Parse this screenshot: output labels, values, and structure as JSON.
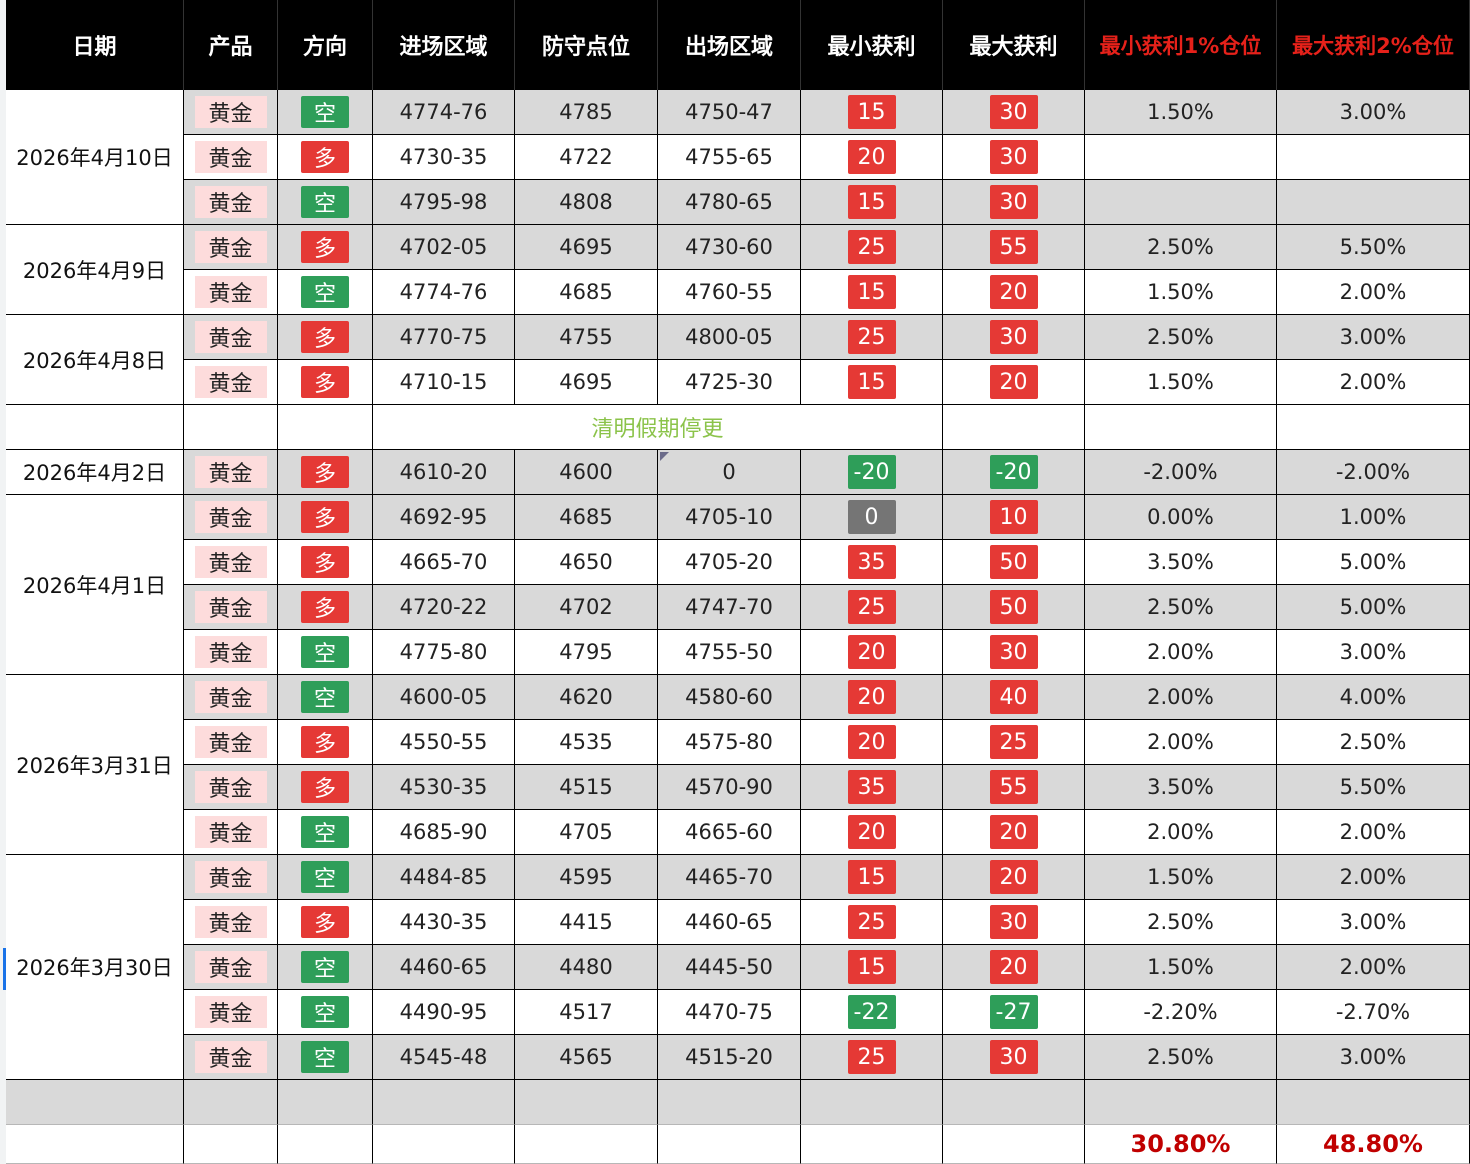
{
  "headers": [
    "日期",
    "产品",
    "方向",
    "进场区域",
    "防守点位",
    "出场区域",
    "最小获利",
    "最大获利",
    "最小获利1%仓位",
    "最大获利2%仓位"
  ],
  "colors": {
    "long": "#e53935",
    "short": "#2e9e59",
    "profit": "#e53935",
    "loss": "#2e9e59",
    "zero": "#757575",
    "header_bg": "#000000",
    "header_red": "#e6211a",
    "product_bg": "#fddcdc",
    "note": "#8bc34a",
    "total": "#c00000"
  },
  "groups": [
    {
      "date": "2026年4月10日",
      "rows": [
        {
          "product": "黄金",
          "direction": "空",
          "entry": "4774-76",
          "defense": "4785",
          "exit": "4750-47",
          "min_profit": "15",
          "max_profit": "30",
          "min_pct": "1.50%",
          "max_pct": "3.00%"
        },
        {
          "product": "黄金",
          "direction": "多",
          "entry": "4730-35",
          "defense": "4722",
          "exit": "4755-65",
          "min_profit": "20",
          "max_profit": "30",
          "min_pct": "",
          "max_pct": ""
        },
        {
          "product": "黄金",
          "direction": "空",
          "entry": "4795-98",
          "defense": "4808",
          "exit": "4780-65",
          "min_profit": "15",
          "max_profit": "30",
          "min_pct": "",
          "max_pct": ""
        }
      ]
    },
    {
      "date": "2026年4月9日",
      "rows": [
        {
          "product": "黄金",
          "direction": "多",
          "entry": "4702-05",
          "defense": "4695",
          "exit": "4730-60",
          "min_profit": "25",
          "max_profit": "55",
          "min_pct": "2.50%",
          "max_pct": "5.50%"
        },
        {
          "product": "黄金",
          "direction": "空",
          "entry": "4774-76",
          "defense": "4685",
          "exit": "4760-55",
          "min_profit": "15",
          "max_profit": "20",
          "min_pct": "1.50%",
          "max_pct": "2.00%"
        }
      ]
    },
    {
      "date": "2026年4月8日",
      "rows": [
        {
          "product": "黄金",
          "direction": "多",
          "entry": "4770-75",
          "defense": "4755",
          "exit": "4800-05",
          "min_profit": "25",
          "max_profit": "30",
          "min_pct": "2.50%",
          "max_pct": "3.00%"
        },
        {
          "product": "黄金",
          "direction": "多",
          "entry": "4710-15",
          "defense": "4695",
          "exit": "4725-30",
          "min_profit": "15",
          "max_profit": "20",
          "min_pct": "1.50%",
          "max_pct": "2.00%"
        }
      ]
    },
    {
      "date": "",
      "note": "清明假期停更",
      "rows": []
    },
    {
      "date": "2026年4月2日",
      "rows": [
        {
          "product": "黄金",
          "direction": "多",
          "entry": "4610-20",
          "defense": "4600",
          "exit": "0",
          "min_profit": "-20",
          "max_profit": "-20",
          "min_pct": "-2.00%",
          "max_pct": "-2.00%"
        }
      ]
    },
    {
      "date": "2026年4月1日",
      "rows": [
        {
          "product": "黄金",
          "direction": "多",
          "entry": "4692-95",
          "defense": "4685",
          "exit": "4705-10",
          "min_profit": "0",
          "max_profit": "10",
          "min_pct": "0.00%",
          "max_pct": "1.00%"
        },
        {
          "product": "黄金",
          "direction": "多",
          "entry": "4665-70",
          "defense": "4650",
          "exit": "4705-20",
          "min_profit": "35",
          "max_profit": "50",
          "min_pct": "3.50%",
          "max_pct": "5.00%"
        },
        {
          "product": "黄金",
          "direction": "多",
          "entry": "4720-22",
          "defense": "4702",
          "exit": "4747-70",
          "min_profit": "25",
          "max_profit": "50",
          "min_pct": "2.50%",
          "max_pct": "5.00%"
        },
        {
          "product": "黄金",
          "direction": "空",
          "entry": "4775-80",
          "defense": "4795",
          "exit": "4755-50",
          "min_profit": "20",
          "max_profit": "30",
          "min_pct": "2.00%",
          "max_pct": "3.00%"
        }
      ]
    },
    {
      "date": "2026年3月31日",
      "rows": [
        {
          "product": "黄金",
          "direction": "空",
          "entry": "4600-05",
          "defense": "4620",
          "exit": "4580-60",
          "min_profit": "20",
          "max_profit": "40",
          "min_pct": "2.00%",
          "max_pct": "4.00%"
        },
        {
          "product": "黄金",
          "direction": "多",
          "entry": "4550-55",
          "defense": "4535",
          "exit": "4575-80",
          "min_profit": "20",
          "max_profit": "25",
          "min_pct": "2.00%",
          "max_pct": "2.50%"
        },
        {
          "product": "黄金",
          "direction": "多",
          "entry": "4530-35",
          "defense": "4515",
          "exit": "4570-90",
          "min_profit": "35",
          "max_profit": "55",
          "min_pct": "3.50%",
          "max_pct": "5.50%"
        },
        {
          "product": "黄金",
          "direction": "空",
          "entry": "4685-90",
          "defense": "4705",
          "exit": "4665-60",
          "min_profit": "20",
          "max_profit": "20",
          "min_pct": "2.00%",
          "max_pct": "2.00%"
        }
      ]
    },
    {
      "date": "2026年3月30日",
      "rows": [
        {
          "product": "黄金",
          "direction": "空",
          "entry": "4484-85",
          "defense": "4595",
          "exit": "4465-70",
          "min_profit": "15",
          "max_profit": "20",
          "min_pct": "1.50%",
          "max_pct": "2.00%"
        },
        {
          "product": "黄金",
          "direction": "多",
          "entry": "4430-35",
          "defense": "4415",
          "exit": "4460-65",
          "min_profit": "25",
          "max_profit": "30",
          "min_pct": "2.50%",
          "max_pct": "3.00%"
        },
        {
          "product": "黄金",
          "direction": "空",
          "entry": "4460-65",
          "defense": "4480",
          "exit": "4445-50",
          "min_profit": "15",
          "max_profit": "20",
          "min_pct": "1.50%",
          "max_pct": "2.00%"
        },
        {
          "product": "黄金",
          "direction": "空",
          "entry": "4490-95",
          "defense": "4517",
          "exit": "4470-75",
          "min_profit": "-22",
          "max_profit": "-27",
          "min_pct": "-2.20%",
          "max_pct": "-2.70%"
        },
        {
          "product": "黄金",
          "direction": "空",
          "entry": "4545-48",
          "defense": "4565",
          "exit": "4515-20",
          "min_profit": "25",
          "max_profit": "30",
          "min_pct": "2.50%",
          "max_pct": "3.00%"
        }
      ]
    }
  ],
  "totals": {
    "min_pct_total": "30.80%",
    "max_pct_total": "48.80%"
  }
}
